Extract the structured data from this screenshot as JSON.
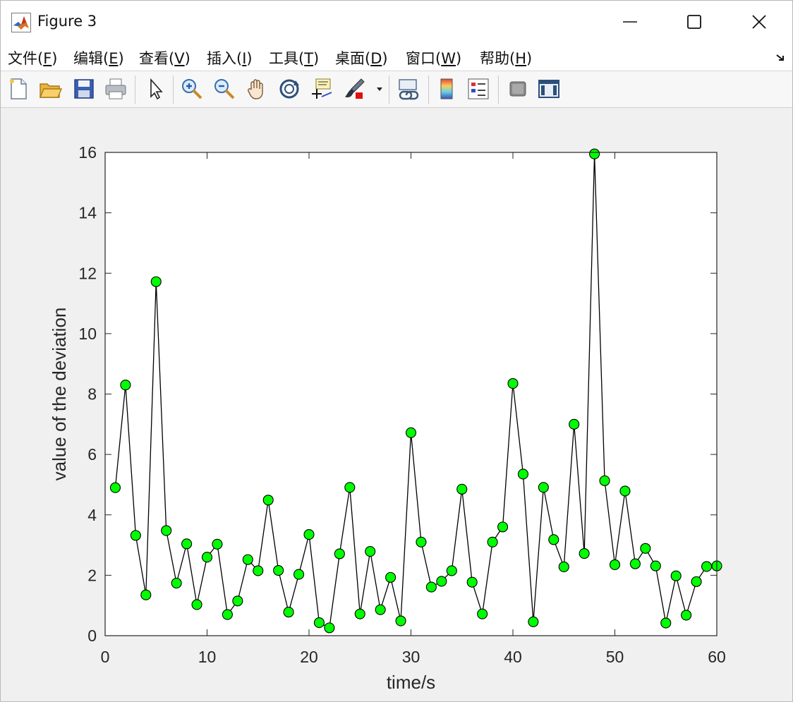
{
  "window": {
    "title": "Figure 3"
  },
  "menu": [
    {
      "label": "文件(",
      "key": "F",
      "tail": ")"
    },
    {
      "label": "编辑(",
      "key": "E",
      "tail": ")"
    },
    {
      "label": "查看(",
      "key": "V",
      "tail": ")"
    },
    {
      "label": "插入(",
      "key": "I",
      "tail": ")"
    },
    {
      "label": "工具(",
      "key": "T",
      "tail": ")"
    },
    {
      "label": "桌面(",
      "key": "D",
      "tail": ")"
    },
    {
      "label": "窗口(",
      "key": "W",
      "tail": ")"
    },
    {
      "label": "帮助(",
      "key": "H",
      "tail": ")"
    }
  ],
  "toolbar": {
    "icons": [
      "new-figure-icon",
      "open-file-icon",
      "save-icon",
      "print-icon",
      "select-pointer-icon",
      "zoom-in-icon",
      "zoom-out-icon",
      "pan-hand-icon",
      "rotate-3d-icon",
      "data-cursor-icon",
      "brush-icon",
      "link-plot-icon",
      "colorbar-icon",
      "legend-icon",
      "hide-plot-tools-icon",
      "show-plot-tools-icon"
    ]
  },
  "colors": {
    "marker_fill": "#00ff00",
    "line": "#000000",
    "axes_bg": "#ffffff",
    "figure_bg": "#f0f0f0"
  },
  "chart_data": {
    "type": "line",
    "title": "",
    "xlabel": "time/s",
    "ylabel": "value of the deviation",
    "xlim": [
      0,
      60
    ],
    "ylim": [
      0,
      16
    ],
    "xticks": [
      0,
      10,
      20,
      30,
      40,
      50,
      60
    ],
    "yticks": [
      0,
      2,
      4,
      6,
      8,
      10,
      12,
      14,
      16
    ],
    "grid": false,
    "marker": "circle",
    "x": [
      1,
      2,
      3,
      4,
      5,
      6,
      7,
      8,
      9,
      10,
      11,
      12,
      13,
      14,
      15,
      16,
      17,
      18,
      19,
      20,
      21,
      22,
      23,
      24,
      25,
      26,
      27,
      28,
      29,
      30,
      31,
      32,
      33,
      34,
      35,
      36,
      37,
      38,
      39,
      40,
      41,
      42,
      43,
      44,
      45,
      46,
      47,
      48,
      49,
      50,
      51,
      52,
      53,
      54,
      55,
      56,
      57,
      58,
      59,
      60
    ],
    "y": [
      4.9,
      8.3,
      3.32,
      1.35,
      11.72,
      3.48,
      1.74,
      3.04,
      1.03,
      2.6,
      3.03,
      0.7,
      1.15,
      2.52,
      2.15,
      4.49,
      2.16,
      0.78,
      2.03,
      3.35,
      0.43,
      0.26,
      2.71,
      4.91,
      0.72,
      2.79,
      0.86,
      1.93,
      0.49,
      6.72,
      3.1,
      1.61,
      1.8,
      2.15,
      4.85,
      1.77,
      0.72,
      3.1,
      3.6,
      8.35,
      5.35,
      0.46,
      4.91,
      3.18,
      2.28,
      7.0,
      2.72,
      15.95,
      5.13,
      2.35,
      4.79,
      2.38,
      2.89,
      2.31,
      0.42,
      1.98,
      0.68,
      1.79,
      2.29,
      2.31
    ]
  }
}
